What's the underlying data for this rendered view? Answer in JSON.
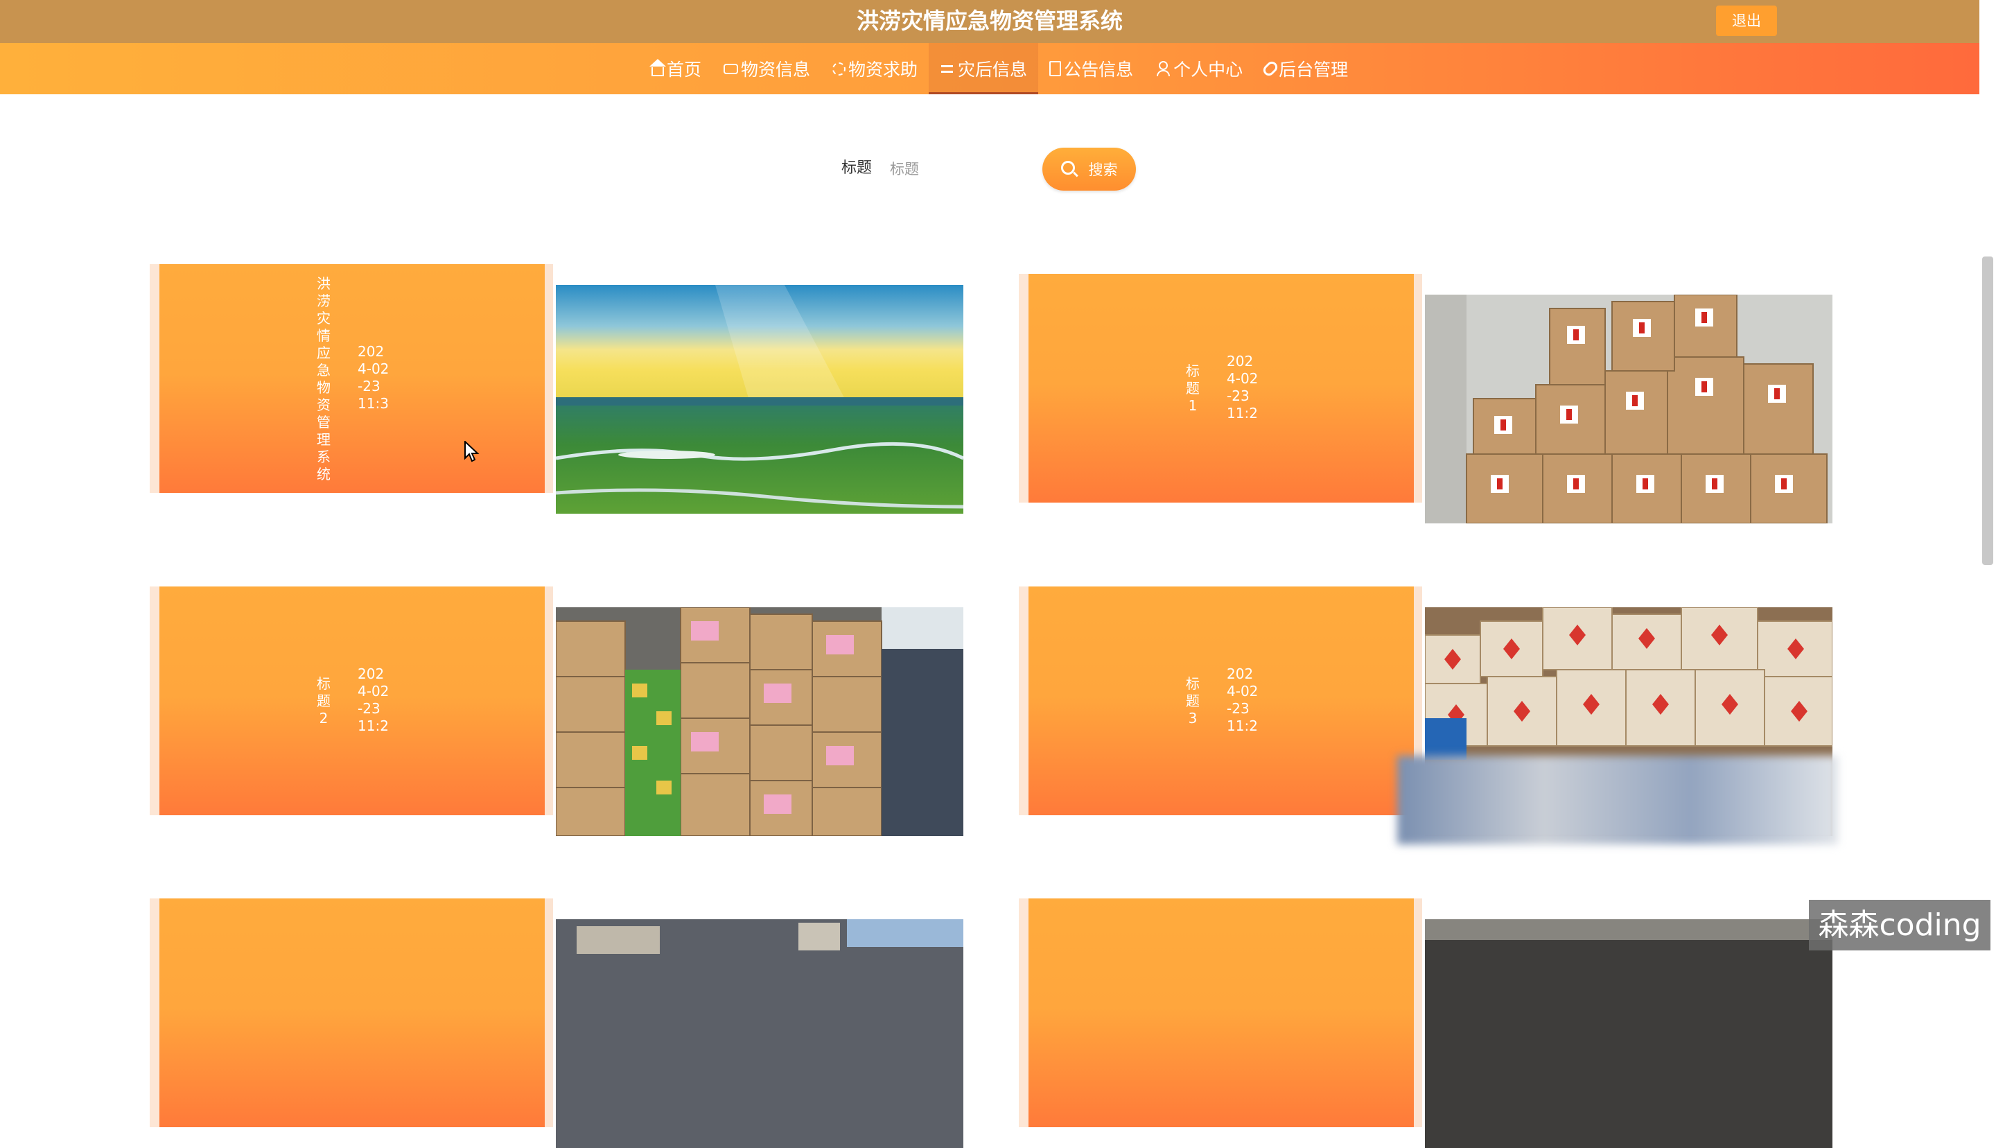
{
  "header": {
    "title": "洪涝灾情应急物资管理系统",
    "logout_label": "退出"
  },
  "nav": {
    "items": [
      {
        "label": "首页",
        "icon": "home-icon"
      },
      {
        "label": "物资信息",
        "icon": "print-icon"
      },
      {
        "label": "物资求助",
        "icon": "recycle-icon"
      },
      {
        "label": "灾后信息",
        "icon": "sliders-icon",
        "active": true
      },
      {
        "label": "公告信息",
        "icon": "document-icon"
      },
      {
        "label": "个人中心",
        "icon": "user-icon"
      },
      {
        "label": "后台管理",
        "icon": "link-icon"
      }
    ]
  },
  "search": {
    "label": "标题",
    "placeholder": "标题",
    "button_label": "搜索"
  },
  "cards": [
    {
      "title": "洪涝灾情应急物资管理系统",
      "date": "2024-02-23 11:3",
      "image": "grassland-river-photo"
    },
    {
      "title": "标题1",
      "date": "2024-02-23 11:2",
      "image": "relief-boxes-photo"
    },
    {
      "title": "标题2",
      "date": "2024-02-23 11:2",
      "image": "warehouse-boxes-photo"
    },
    {
      "title": "标题3",
      "date": "2024-02-23 11:2",
      "image": "stacked-cartons-photo"
    },
    {
      "title": "",
      "date": "",
      "image": "supplies-photo"
    },
    {
      "title": "",
      "date": "",
      "image": "supplies-photo"
    }
  ],
  "watermark": "森森coding",
  "colors": {
    "header_bg": "#c8934f",
    "nav_gradient_start": "#ffb03b",
    "nav_gradient_end": "#ff6a3c",
    "accent": "#ff9f2f"
  }
}
